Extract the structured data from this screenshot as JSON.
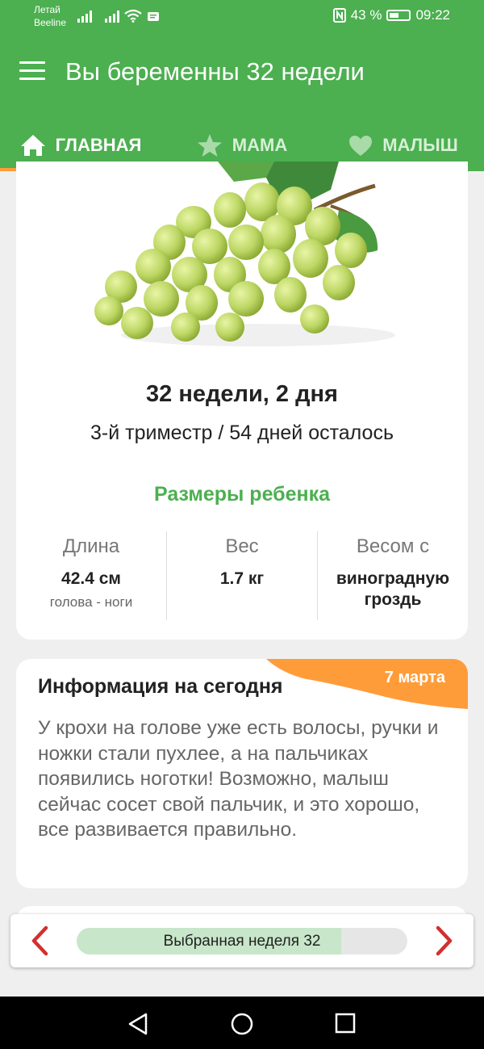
{
  "status_bar": {
    "carrier_line1": "Летай",
    "carrier_line2": "Beeline",
    "battery": "43 %",
    "time": "09:22"
  },
  "app_bar": {
    "title": "Вы беременны 32 недели",
    "menu_icon": "hamburger-menu-icon"
  },
  "tabs": [
    {
      "label": "ГЛАВНАЯ",
      "icon": "home-icon",
      "active": true
    },
    {
      "label": "МАМА",
      "icon": "star-icon",
      "active": false
    },
    {
      "label": "МАЛЫШ",
      "icon": "heart-icon",
      "active": false
    }
  ],
  "summary": {
    "week_day": "32 недели, 2 дня",
    "trimester": "3-й триместр / 54 дней осталось",
    "sizes_title": "Размеры ребенка",
    "length": {
      "label": "Длина",
      "value": "42.4 см",
      "sub": "голова - ноги"
    },
    "weight": {
      "label": "Вес",
      "value": "1.7 кг"
    },
    "compare": {
      "label": "Весом с",
      "value": "виноградную гроздь"
    }
  },
  "info": {
    "date": "7 марта",
    "title": "Информация на сегодня",
    "text": "У крохи на голове уже есть волосы, ручки и ножки стали пухлее, а на пальчиках появились ноготки! Возможно, малыш сейчас сосет свой пальчик, и это хорошо, все развивается правильно."
  },
  "week_selector": {
    "label": "Выбранная неделя 32",
    "progress": 0.8
  },
  "colors": {
    "primary": "#4caf50",
    "accent": "#ff9c3a",
    "arrow": "#d32f2f"
  }
}
